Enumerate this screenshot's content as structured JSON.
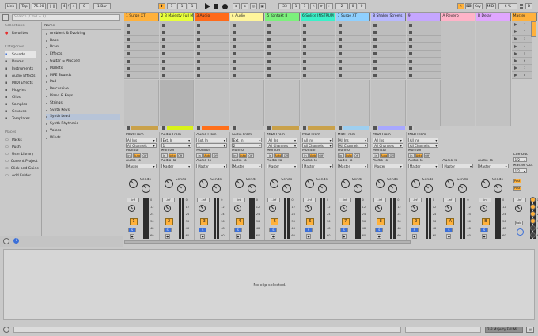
{
  "transport": {
    "link": "Link",
    "tap": "Tap",
    "tempo": "75.00",
    "sig_num": "4",
    "sig_den": "4",
    "metro": "-0-",
    "bar": "1 Bar",
    "pos1": "1",
    "pos2": "1",
    "pos3": "1",
    "loop_start": "33",
    "loop_s2": "1",
    "loop_s3": "1",
    "loop_len1": "2",
    "loop_len2": "0",
    "loop_len3": "0",
    "key": "Key",
    "midi": "MIDI",
    "cpu": "6 %",
    "d_label": "D"
  },
  "browser": {
    "search_placeholder": "Search (Cmd + F)",
    "collections_title": "Collections",
    "favorites": "Favorites",
    "categories_title": "Categories",
    "categories": [
      {
        "label": "Sounds",
        "icon": "sounds-icon"
      },
      {
        "label": "Drums",
        "icon": "drums-icon"
      },
      {
        "label": "Instruments",
        "icon": "instruments-icon"
      },
      {
        "label": "Audio Effects",
        "icon": "audio-effects-icon"
      },
      {
        "label": "MIDI Effects",
        "icon": "midi-effects-icon"
      },
      {
        "label": "Plug-Ins",
        "icon": "plugins-icon"
      },
      {
        "label": "Clips",
        "icon": "clips-icon"
      },
      {
        "label": "Samples",
        "icon": "samples-icon"
      },
      {
        "label": "Grooves",
        "icon": "grooves-icon"
      },
      {
        "label": "Templates",
        "icon": "templates-icon"
      }
    ],
    "places_title": "Places",
    "places": [
      {
        "label": "Packs"
      },
      {
        "label": "Push"
      },
      {
        "label": "User Library"
      },
      {
        "label": "Current Project"
      },
      {
        "label": "Click and Guide"
      },
      {
        "label": "Add Folder..."
      }
    ],
    "name_header": "Name",
    "items": [
      "Ambient & Evolving",
      "Bass",
      "Brass",
      "Effects",
      "Guitar & Plucked",
      "Mallets",
      "MPE Sounds",
      "Pad",
      "Percussive",
      "Piano & Keys",
      "Strings",
      "Synth Keys",
      "Synth Lead",
      "Synth Rhythmic",
      "Voices",
      "Winds"
    ],
    "selected_index": 12
  },
  "tracks": [
    {
      "name": "1 Surge XT",
      "color": "#ffb13b",
      "type": "midi",
      "num": "1",
      "input": "All Ins",
      "channel": "All Channels",
      "outto": "Master",
      "clip": "#c9a14a"
    },
    {
      "name": "2 B Majesty Full M",
      "color": "#e8ff3b",
      "type": "audio",
      "num": "2",
      "input": "Ext. In",
      "channel": "1",
      "outto": "Master",
      "clip": "#d9f218"
    },
    {
      "name": "3 Audio",
      "color": "#ff6a1a",
      "type": "audio",
      "num": "3",
      "input": "Ext. In",
      "channel": "1",
      "outto": "Master",
      "clip": "#ff6f1a"
    },
    {
      "name": "4 Audio",
      "color": "#fff59b",
      "type": "audio",
      "num": "4",
      "input": "Ext. In",
      "channel": "2",
      "outto": "Master",
      "clip": ""
    },
    {
      "name": "5 Kontakt 8",
      "color": "#7cf07c",
      "type": "midi",
      "num": "5",
      "input": "All Ins",
      "channel": "All Channels",
      "outto": "Master",
      "clip": "#c9a14a"
    },
    {
      "name": "6 Splice INSTRUM",
      "color": "#3bf0c8",
      "type": "midi",
      "num": "6",
      "input": "All Ins",
      "channel": "All Channels",
      "outto": "Master",
      "clip": "#c9a14a"
    },
    {
      "name": "7 Surge XT",
      "color": "#8fd0ff",
      "type": "midi",
      "num": "7",
      "input": "All Ins",
      "channel": "All Channels",
      "outto": "Master",
      "clip": "#9ecff0"
    },
    {
      "name": "8 Shaker Streets",
      "color": "#b8b8ff",
      "type": "midi",
      "num": "8",
      "input": "All Ins",
      "channel": "All Channels",
      "outto": "Master",
      "clip": "#a8a8ff"
    },
    {
      "name": "9",
      "color": "#c5a6ff",
      "type": "midi",
      "num": "9",
      "input": "All Ins",
      "channel": "All Channels",
      "outto": "Master",
      "clip": ""
    }
  ],
  "returns": [
    {
      "name": "A Reverb",
      "color": "#ffb3c8",
      "letter": "A",
      "outto": "Master"
    },
    {
      "name": "B Delay",
      "color": "#e0a6ff",
      "letter": "B",
      "outto": "Master"
    }
  ],
  "master": {
    "name": "Master",
    "color": "#ffb13b",
    "scenes": [
      "1",
      "2",
      "3",
      "4",
      "5",
      "6",
      "7",
      "8"
    ],
    "cue_out_label": "Cue Out",
    "cue_out": "1/2",
    "master_out_label": "Master Out",
    "master_out": "1/2",
    "solo": "Solo"
  },
  "labels": {
    "midi_from": "MIDI From",
    "audio_from": "Audio From",
    "monitor": "Monitor",
    "in": "In",
    "auto": "Auto",
    "off": "Off",
    "midi_to": "MIDI To",
    "audio_to": "Audio To",
    "sends": "Sends",
    "inf": "-inf",
    "post": "Post",
    "s": "S",
    "mute_icon": "●"
  },
  "meter_ticks": [
    "0",
    "12",
    "24",
    "36",
    "48",
    "60"
  ],
  "detail": {
    "message": "No clip selected."
  },
  "status": {
    "selected_track": "2-B Majesty Full Mi"
  }
}
